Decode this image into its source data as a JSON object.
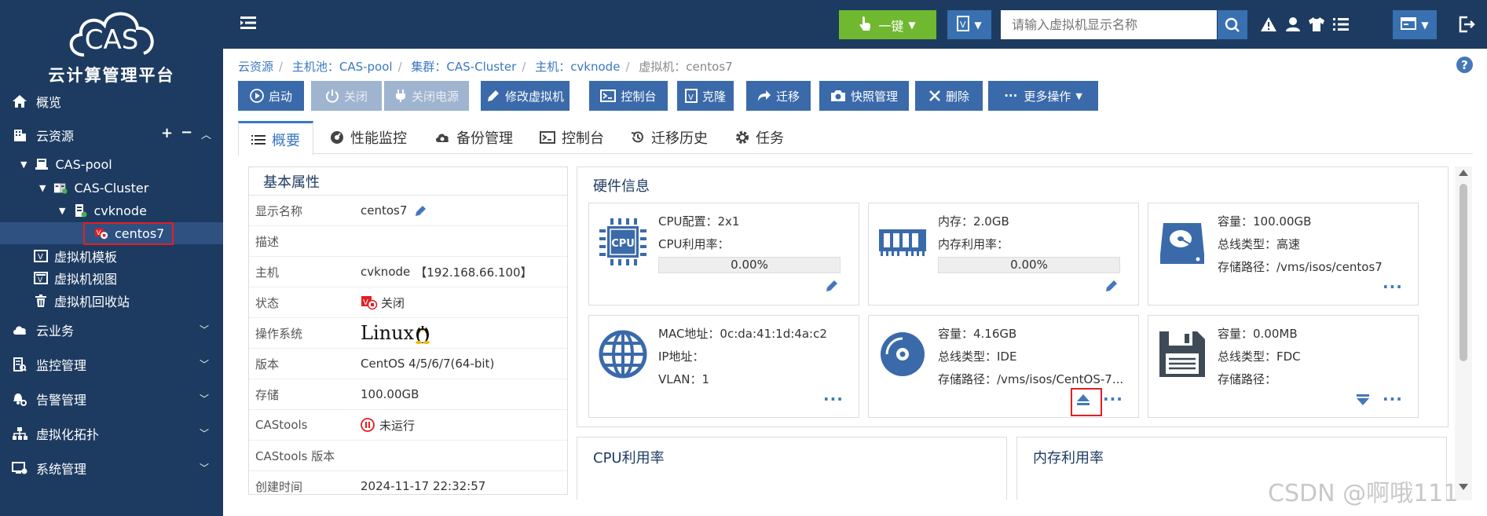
{
  "app": {
    "logo_text": "CAS",
    "title": "云计算管理平台"
  },
  "sidebar": {
    "overview": "概览",
    "cloud_resources": "云资源",
    "tree": {
      "pool": "CAS-pool",
      "cluster": "CAS-Cluster",
      "host": "cvknode",
      "vm": "centos7"
    },
    "vm_template": "虚拟机模板",
    "vm_view": "虚拟机视图",
    "vm_recycle": "虚拟机回收站",
    "cloud_business": "云业务",
    "monitoring": "监控管理",
    "alarm": "告警管理",
    "topology": "虚拟化拓扑",
    "system": "系统管理"
  },
  "topbar": {
    "one_click": "一键",
    "search_placeholder": "请输入虚拟机显示名称"
  },
  "breadcrumb": {
    "root": "云资源",
    "pool": "主机池：CAS-pool",
    "cluster": "集群：CAS-Cluster",
    "host": "主机：cvknode",
    "vm": "虚拟机：centos7"
  },
  "toolbar": {
    "start": "启动",
    "shutdown": "关闭",
    "power_off": "关闭电源",
    "modify": "修改虚拟机",
    "console": "控制台",
    "clone": "克隆",
    "migrate": "迁移",
    "snapshot": "快照管理",
    "delete": "删除",
    "more": "更多操作"
  },
  "tabs": {
    "overview": "概要",
    "perf": "性能监控",
    "backup": "备份管理",
    "console": "控制台",
    "migrate_history": "迁移历史",
    "task": "任务"
  },
  "basic": {
    "title": "基本属性",
    "display_name_k": "显示名称",
    "display_name_v": "centos7",
    "desc_k": "描述",
    "host_k": "主机",
    "host_v": "cvknode",
    "host_ip": "【192.168.66.100】",
    "status_k": "状态",
    "status_v": "关闭",
    "os_k": "操作系统",
    "os_v": "Linux",
    "version_k": "版本",
    "version_v": "CentOS 4/5/6/7(64-bit)",
    "storage_k": "存储",
    "storage_v": "100.00GB",
    "castools_k": "CAStools",
    "castools_v": "未运行",
    "castools_ver_k": "CAStools 版本",
    "created_k": "创建时间",
    "created_v": "2024-11-17 22:32:57"
  },
  "hardware": {
    "title": "硬件信息",
    "cpu": {
      "icon_text": "CPU",
      "config": "CPU配置：2x1",
      "usage_label": "CPU利用率：",
      "usage": "0.00%"
    },
    "memory": {
      "size": "内存：2.0GB",
      "usage_label": "内存利用率：",
      "usage": "0.00%"
    },
    "disk": {
      "capacity": "容量：100.00GB",
      "bus": "总线类型：高速",
      "path": "存储路径：/vms/isos/centos7"
    },
    "network": {
      "mac": "MAC地址：0c:da:41:1d:4a:c2",
      "ip": "IP地址：",
      "vlan": "VLAN：1"
    },
    "cdrom": {
      "capacity": "容量：4.16GB",
      "bus": "总线类型：IDE",
      "path": "存储路径：/vms/isos/CentOS-7..."
    },
    "floppy": {
      "capacity": "容量：0.00MB",
      "bus": "总线类型：FDC",
      "path": "存储路径："
    }
  },
  "charts": {
    "cpu_title": "CPU利用率",
    "mem_title": "内存利用率"
  },
  "watermark": "CSDN @啊哦111",
  "colors": {
    "sidebar_bg": "#1d3b61",
    "accent": "#3a6aaa",
    "green": "#6fb82f",
    "highlight_red": "#e31e24"
  }
}
